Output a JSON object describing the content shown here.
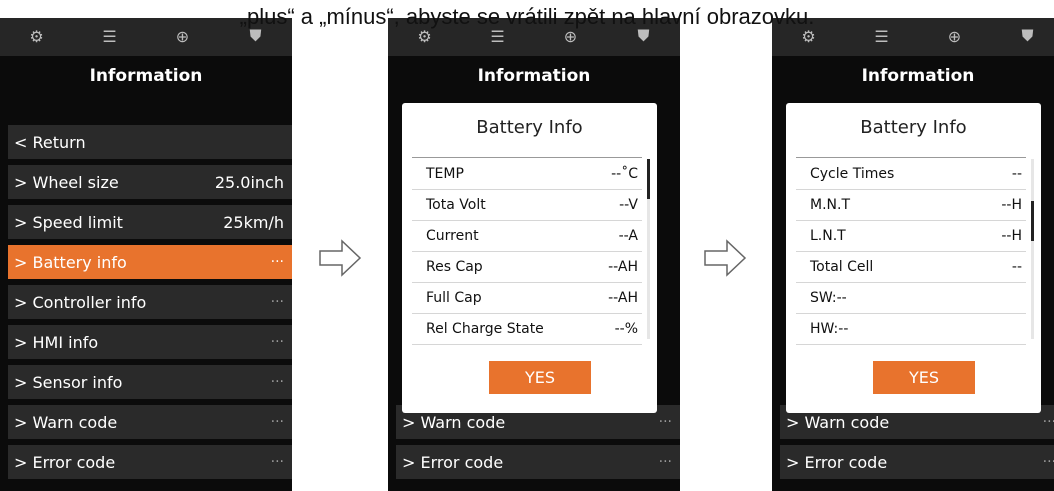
{
  "caption": "„plus“ a „mínus“, abyste se vrátili zpět na hlavní obrazovku.",
  "topbar_icons": [
    "settings-icon",
    "list-icon",
    "globe-icon",
    "shirt-icon"
  ],
  "topbar_glyphs": [
    "⚙",
    "☰",
    "⊕",
    "⛊"
  ],
  "screens": [
    {
      "title": "Information",
      "items": [
        {
          "label": "< Return",
          "value": ""
        },
        {
          "label": "> Wheel size",
          "value": "25.0inch"
        },
        {
          "label": "> Speed limit",
          "value": "25km/h"
        },
        {
          "label": "> Battery info",
          "value": "···"
        },
        {
          "label": "> Controller info",
          "value": "···"
        },
        {
          "label": "> HMI info",
          "value": "···"
        },
        {
          "label": "> Sensor info",
          "value": "···"
        },
        {
          "label": "> Warn code",
          "value": "···"
        },
        {
          "label": "> Error code",
          "value": "···"
        }
      ],
      "active_index": 3
    },
    {
      "title": "Information",
      "bg_items": [
        {
          "label": "> Warn code",
          "value": "···"
        },
        {
          "label": "> Error code",
          "value": "···"
        }
      ],
      "dialog": {
        "title": "Battery Info",
        "rows": [
          {
            "k": "TEMP",
            "v": "--˚C"
          },
          {
            "k": "Tota Volt",
            "v": "--V"
          },
          {
            "k": "Current",
            "v": "--A"
          },
          {
            "k": "Res Cap",
            "v": "--AH"
          },
          {
            "k": "Full Cap",
            "v": "--AH"
          },
          {
            "k": "Rel Charge State",
            "v": "--%"
          }
        ],
        "button": "YES",
        "scroll_position": 0.0
      }
    },
    {
      "title": "Information",
      "bg_items": [
        {
          "label": "> Warn code",
          "value": "···"
        },
        {
          "label": "> Error code",
          "value": "···"
        }
      ],
      "dialog": {
        "title": "Battery Info",
        "rows": [
          {
            "k": "Cycle Times",
            "v": "--"
          },
          {
            "k": "M.N.T",
            "v": "--H"
          },
          {
            "k": "L.N.T",
            "v": "--H"
          },
          {
            "k": "Total Cell",
            "v": "--"
          },
          {
            "k": "SW:--",
            "v": ""
          },
          {
            "k": "HW:--",
            "v": ""
          }
        ],
        "button": "YES",
        "scroll_position": 0.3
      }
    }
  ],
  "colors": {
    "accent": "#e8732d",
    "screen_bg": "#0b0b0b",
    "item_bg": "#2a2a2a",
    "topbar_bg": "#262626"
  }
}
